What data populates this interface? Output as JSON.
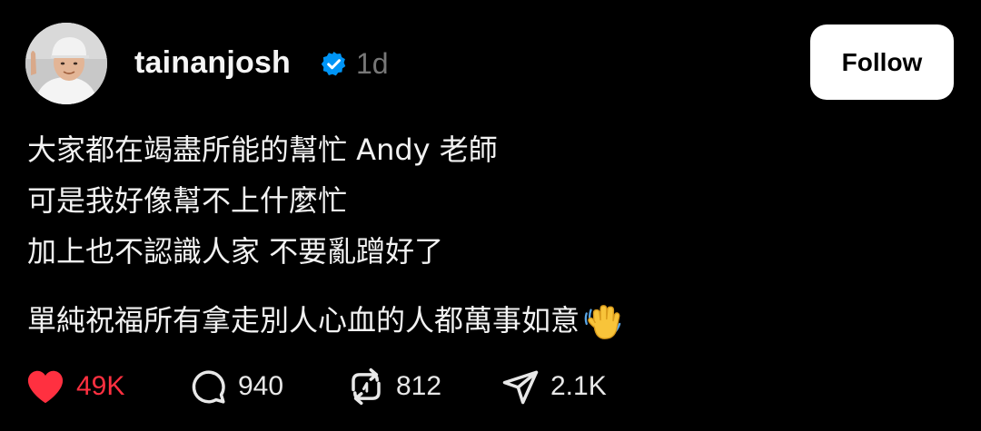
{
  "post": {
    "author": {
      "username": "tainanjosh",
      "verified_icon": "verified-badge-icon",
      "timestamp": "1d"
    },
    "follow_label": "Follow",
    "text_lines": [
      "大家都在竭盡所能的幫忙 Andy 老師",
      "可是我好像幫不上什麼忙",
      "加上也不認識人家 不要亂蹭好了",
      "單純祝福所有拿走別人心血的人都萬事如意"
    ],
    "emoji": "waving-hand-emoji",
    "actions": {
      "like": {
        "icon": "heart-icon",
        "count": "49K",
        "active": true
      },
      "reply": {
        "icon": "comment-icon",
        "count": "940"
      },
      "repost": {
        "icon": "repost-icon",
        "count": "812"
      },
      "share": {
        "icon": "send-icon",
        "count": "2.1K"
      }
    },
    "colors": {
      "background": "#000000",
      "like_active": "#ff3040",
      "verified": "#0095f6",
      "timestamp": "#777777"
    }
  }
}
